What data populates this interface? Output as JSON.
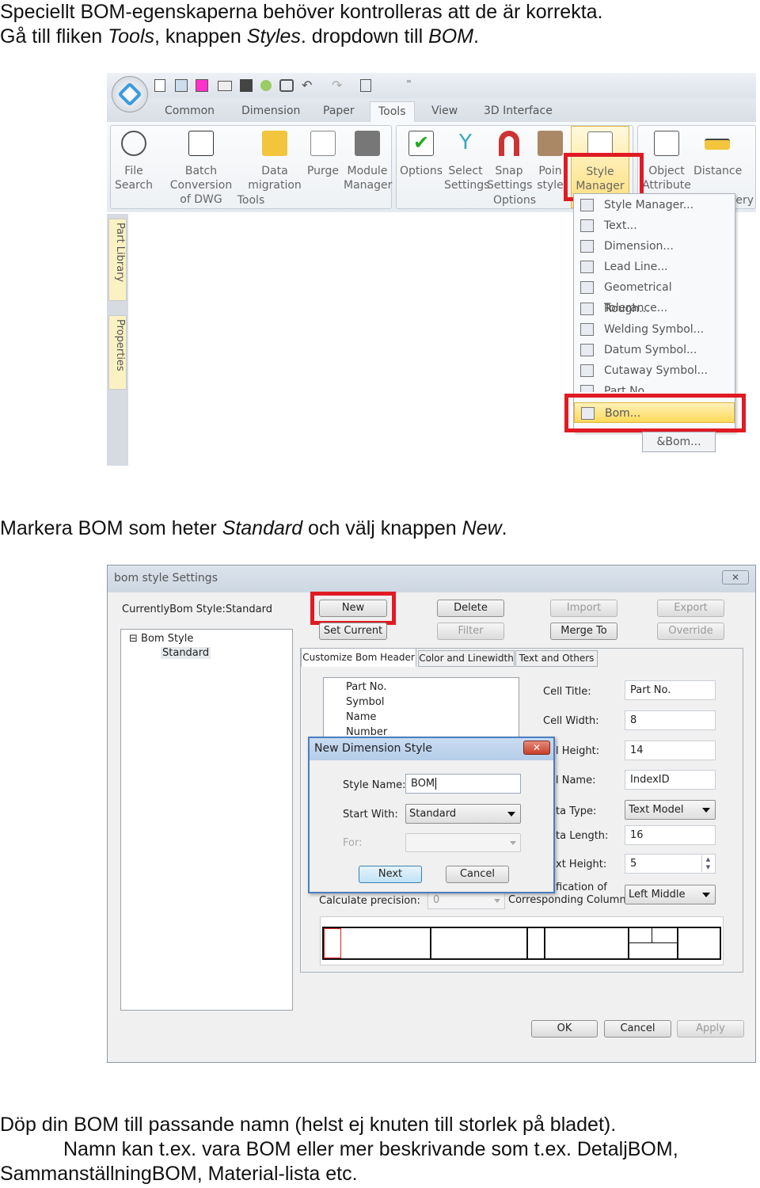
{
  "intro": {
    "line1": "Speciellt BOM-egenskaperna behöver kontrolleras att de är korrekta.",
    "line2_a": "Gå till fliken ",
    "line2_tools": "Tools",
    "line2_b": ", knappen ",
    "line2_styles": "Styles",
    "line2_c": ". dropdown till ",
    "line2_bom": "BOM",
    "line2_d": "."
  },
  "ribbon": {
    "tabs": [
      "Common",
      "Dimension",
      "Paper",
      "Tools",
      "View",
      "3D Interface"
    ],
    "active_tab": "Tools",
    "groups": {
      "tools": "Tools",
      "options": "Options",
      "query_partial": "uery"
    },
    "tools_buttons": [
      [
        "File",
        "Search"
      ],
      [
        "Batch Conversion",
        "of DWG"
      ],
      [
        "Data",
        "migration"
      ],
      [
        "Purge",
        ""
      ],
      [
        "Module",
        "Manager"
      ]
    ],
    "options_buttons": [
      [
        "Options",
        ""
      ],
      [
        "Select",
        "Settings"
      ],
      [
        "Snap",
        "Settings"
      ],
      [
        "Poin",
        "style"
      ],
      [
        "Style",
        "Manager ▾"
      ]
    ],
    "query_buttons": [
      [
        "Object",
        "Attribute"
      ],
      [
        "Distance",
        ""
      ]
    ],
    "side_tabs": [
      "Part Library",
      "Properties"
    ],
    "menu_items": [
      "Style Manager...",
      "Text...",
      "Dimension...",
      "Lead Line...",
      "Geometrical Tolerance...",
      "Rough...",
      "Welding Symbol...",
      "Datum Symbol...",
      "Cutaway Symbol...",
      "Part No...",
      "Bom..."
    ],
    "highlighted_item": "Bom...",
    "extra_button": "&Bom...",
    "highlight_color": "#e01b24"
  },
  "step2": {
    "a": "Markera BOM som heter ",
    "standard": "Standard",
    "b": " och välj knappen ",
    "new": "New",
    "c": "."
  },
  "bom_dialog": {
    "title": "bom style Settings",
    "current": "CurrentlyBom Style:Standard",
    "buttons": {
      "new": "New",
      "delete": "Delete",
      "import": "Import",
      "export": "Export",
      "set_current": "Set Current",
      "filter": "Filter",
      "merge_to": "Merge To",
      "override": "Override",
      "ok": "OK",
      "cancel": "Cancel",
      "apply": "Apply"
    },
    "tree": {
      "root": "Bom Style",
      "child": "Standard"
    },
    "tabs": [
      "Customize Bom Header",
      "Color and Linewidth",
      "Text and Others"
    ],
    "header_items": [
      "Part No.",
      "Symbol",
      "Name",
      "Number"
    ],
    "fields": {
      "cell_title_label": "Cell Title:",
      "cell_title": "Part No.",
      "cell_width_label": "Cell Width:",
      "cell_width": "8",
      "cell_height_label": "l Height:",
      "cell_height": "14",
      "cell_name_label": "l Name:",
      "cell_name": "IndexID",
      "data_type_label": "ta Type:",
      "data_type": "Text Model",
      "data_length_label": "ta Length:",
      "data_length": "16",
      "text_height_label": "xt Height:",
      "text_height": "5",
      "justification_label1": "fication of",
      "justification_label2": "Corresponding Column:",
      "justification": "Left Middle",
      "calc_precision_label": "Calculate precision:",
      "calc_precision": "0"
    }
  },
  "new_style_dialog": {
    "title": "New Dimension Style",
    "style_name_label": "Style Name:",
    "style_name": "BOM",
    "start_with_label": "Start With:",
    "start_with": "Standard",
    "for_label": "For:",
    "next": "Next",
    "cancel": "Cancel"
  },
  "outro": {
    "line1": "Döp din BOM till passande namn (helst ej knuten till storlek på bladet).",
    "line2": "Namn kan t.ex. vara BOM eller mer beskrivande som t.ex. DetaljBOM,",
    "line3": "SammanställningBOM, Material-lista etc."
  }
}
